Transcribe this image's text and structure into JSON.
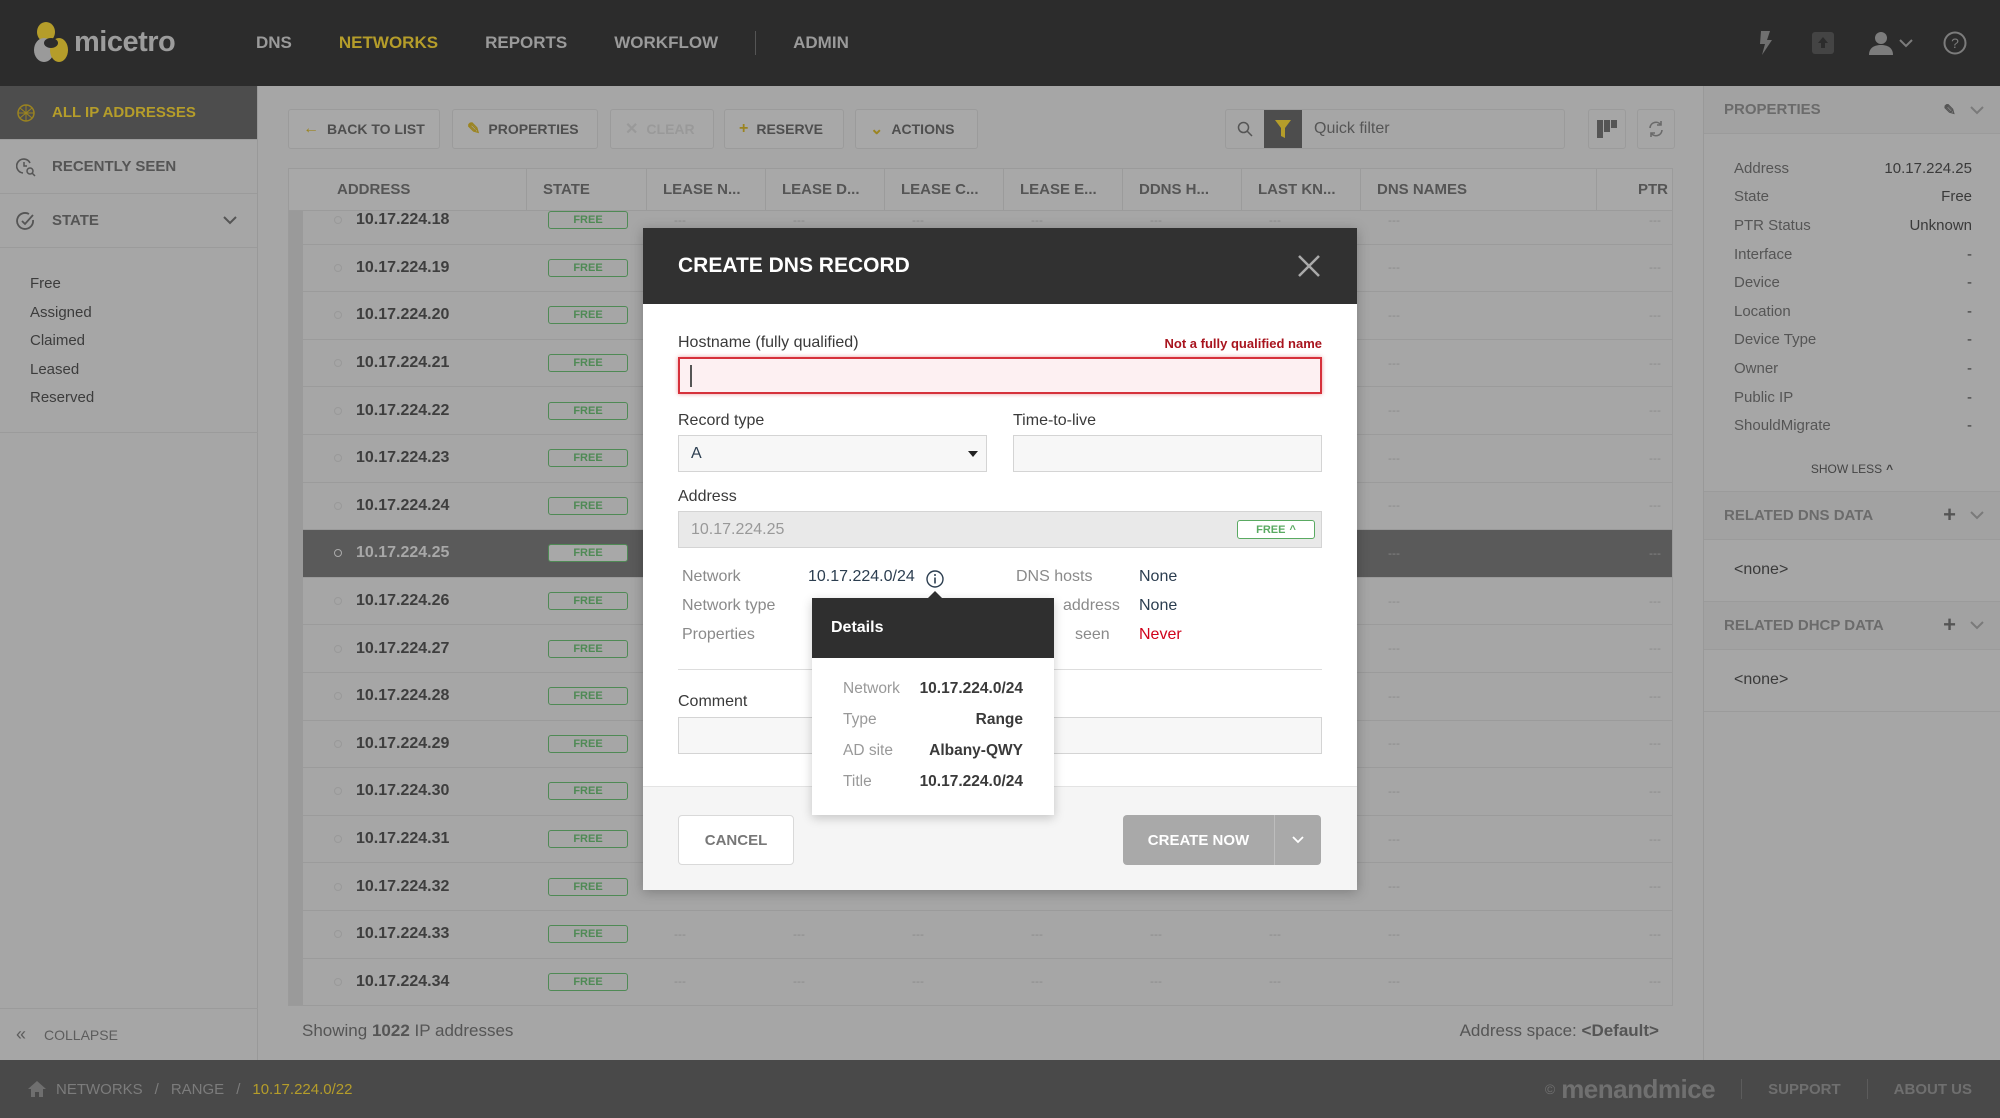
{
  "app": {
    "name": "micetro"
  },
  "nav": {
    "items": [
      "DNS",
      "NETWORKS",
      "REPORTS",
      "WORKFLOW",
      "ADMIN"
    ],
    "active": "NETWORKS"
  },
  "sidebar": {
    "items": [
      {
        "label": "ALL IP ADDRESSES",
        "icon": "network-globe-icon"
      },
      {
        "label": "RECENTLY SEEN",
        "icon": "clock-search-icon"
      },
      {
        "label": "STATE",
        "icon": "check-circle-icon"
      }
    ],
    "state_options": [
      "Free",
      "Assigned",
      "Claimed",
      "Leased",
      "Reserved"
    ],
    "collapse_label": "COLLAPSE"
  },
  "toolbar": {
    "back": "BACK TO LIST",
    "properties": "PROPERTIES",
    "clear": "CLEAR",
    "reserve": "RESERVE",
    "actions": "ACTIONS",
    "quick_filter_placeholder": "Quick filter"
  },
  "table": {
    "columns": [
      "ADDRESS",
      "STATE",
      "LEASE N...",
      "LEASE D...",
      "LEASE C...",
      "LEASE E...",
      "DDNS H...",
      "LAST KN...",
      "DNS NAMES",
      "PTR"
    ],
    "rows": [
      {
        "address": "10.17.224.18",
        "state": "FREE"
      },
      {
        "address": "10.17.224.19",
        "state": "FREE"
      },
      {
        "address": "10.17.224.20",
        "state": "FREE"
      },
      {
        "address": "10.17.224.21",
        "state": "FREE"
      },
      {
        "address": "10.17.224.22",
        "state": "FREE"
      },
      {
        "address": "10.17.224.23",
        "state": "FREE"
      },
      {
        "address": "10.17.224.24",
        "state": "FREE"
      },
      {
        "address": "10.17.224.25",
        "state": "FREE",
        "selected": true
      },
      {
        "address": "10.17.224.26",
        "state": "FREE"
      },
      {
        "address": "10.17.224.27",
        "state": "FREE"
      },
      {
        "address": "10.17.224.28",
        "state": "FREE"
      },
      {
        "address": "10.17.224.29",
        "state": "FREE"
      },
      {
        "address": "10.17.224.30",
        "state": "FREE"
      },
      {
        "address": "10.17.224.31",
        "state": "FREE"
      },
      {
        "address": "10.17.224.32",
        "state": "FREE"
      },
      {
        "address": "10.17.224.33",
        "state": "FREE"
      },
      {
        "address": "10.17.224.34",
        "state": "FREE"
      }
    ],
    "empty_cell": "---",
    "footer_prefix": "Showing",
    "footer_count": "1022",
    "footer_suffix": "IP addresses",
    "address_space_label": "Address space:",
    "address_space_value": "<Default>"
  },
  "properties_panel": {
    "title": "PROPERTIES",
    "props": [
      {
        "key": "Address",
        "value": "10.17.224.25"
      },
      {
        "key": "State",
        "value": "Free"
      },
      {
        "key": "PTR Status",
        "value": "Unknown"
      },
      {
        "key": "Interface",
        "value": "-"
      },
      {
        "key": "Device",
        "value": "-"
      },
      {
        "key": "Location",
        "value": "-"
      },
      {
        "key": "Device Type",
        "value": "-"
      },
      {
        "key": "Owner",
        "value": "-"
      },
      {
        "key": "Public IP",
        "value": "-"
      },
      {
        "key": "ShouldMigrate",
        "value": "-"
      }
    ],
    "show_less": "SHOW LESS",
    "related_dns_title": "RELATED DNS DATA",
    "related_dns_value": "<none>",
    "related_dhcp_title": "RELATED DHCP DATA",
    "related_dhcp_value": "<none>"
  },
  "bottom_bar": {
    "breadcrumb": [
      "NETWORKS",
      "RANGE",
      "10.17.224.0/22"
    ],
    "copyright": "©",
    "brand": "menandmice",
    "support": "SUPPORT",
    "about": "ABOUT US"
  },
  "modal": {
    "title": "CREATE DNS RECORD",
    "hostname_label": "Hostname (fully qualified)",
    "hostname_error": "Not a fully qualified name",
    "hostname_value": "",
    "record_type_label": "Record type",
    "record_type_value": "A",
    "ttl_label": "Time-to-live",
    "ttl_value": "",
    "address_label": "Address",
    "address_value": "10.17.224.25",
    "address_state": "FREE",
    "info": {
      "network_label": "Network",
      "network_value": "10.17.224.0/24",
      "network_type_label": "Network type",
      "properties_label": "Properties",
      "dns_hosts_label": "DNS hosts",
      "dns_hosts_value": "None",
      "address_label_partial": "address",
      "address_value": "None",
      "seen_label_partial": "seen",
      "seen_value": "Never"
    },
    "comment_label": "Comment",
    "comment_value": "",
    "cancel": "CANCEL",
    "create": "CREATE NOW"
  },
  "popover": {
    "title": "Details",
    "rows": [
      {
        "key": "Network",
        "value": "10.17.224.0/24"
      },
      {
        "key": "Type",
        "value": "Range"
      },
      {
        "key": "AD site",
        "value": "Albany-QWY"
      },
      {
        "key": "Title",
        "value": "10.17.224.0/24"
      }
    ]
  },
  "colors": {
    "accent": "#b59d2a",
    "error": "#a8141e",
    "free": "#4f8a55",
    "never": "#d0021b"
  }
}
